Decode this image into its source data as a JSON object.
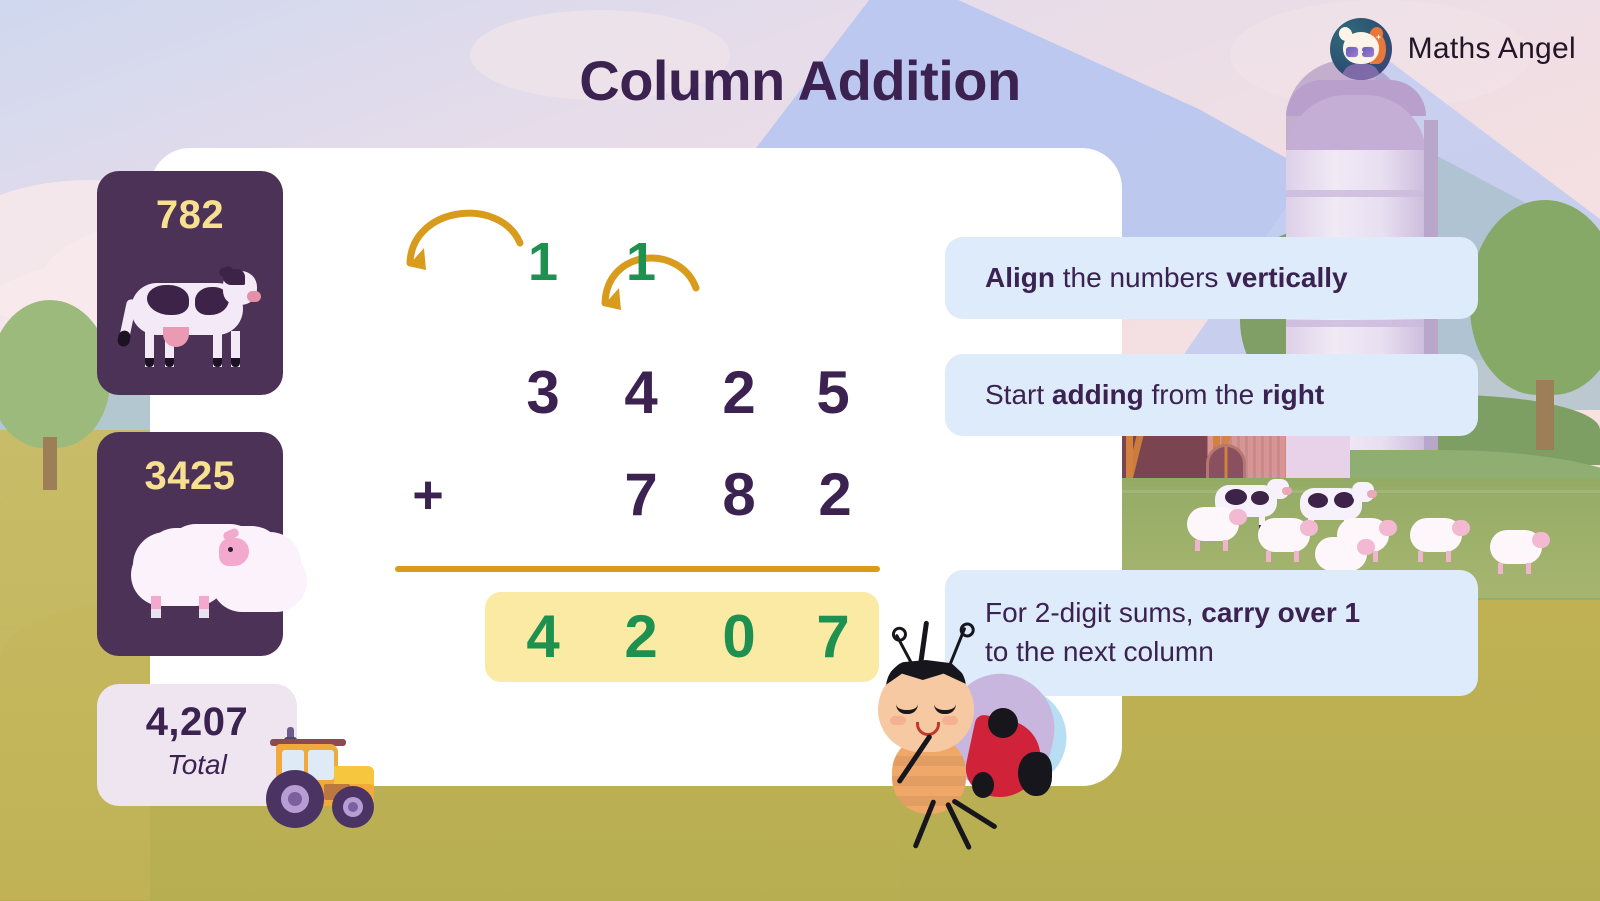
{
  "header": {
    "title": "Column Addition",
    "brand_name": "Maths Angel",
    "logo_icon": "fox-avatar-icon"
  },
  "cards": [
    {
      "name": "cow-card",
      "value": "782",
      "animal": "cow-illustration"
    },
    {
      "name": "sheep-card",
      "value": "3425",
      "animal": "sheep-illustration"
    }
  ],
  "total_card": {
    "value": "4,207",
    "label": "Total"
  },
  "sum": {
    "operator": "+",
    "carries": [
      "1",
      "1"
    ],
    "addend1": [
      "3",
      "4",
      "2",
      "5"
    ],
    "addend2": [
      "7",
      "8",
      "2"
    ],
    "result": [
      "4",
      "2",
      "0",
      "7"
    ],
    "arrow_icon": "carry-arrow-icon"
  },
  "callouts": [
    {
      "name": "callout-align",
      "segments": [
        {
          "text": "Align",
          "bold": true
        },
        {
          "text": " the numbers ",
          "bold": false
        },
        {
          "text": "vertically",
          "bold": true
        }
      ]
    },
    {
      "name": "callout-start-right",
      "segments": [
        {
          "text": "Start ",
          "bold": false
        },
        {
          "text": "adding",
          "bold": true
        },
        {
          "text": " from the ",
          "bold": false
        },
        {
          "text": "right",
          "bold": true
        }
      ]
    },
    {
      "name": "callout-carry-over",
      "segments": [
        {
          "text": "For 2-digit sums, ",
          "bold": false
        },
        {
          "text": "carry over  1",
          "bold": true
        },
        {
          "text": "\nto the next column",
          "bold": false
        }
      ]
    }
  ],
  "mascot": {
    "name": "ladybug-mascot",
    "icon": "ladybug-icon"
  },
  "scene": {
    "tractor": "tractor-illustration",
    "barn": "barn-illustration",
    "silo": "silo-illustration"
  },
  "colors": {
    "title": "#3B2250",
    "card_dark": "#4D3258",
    "card_number": "#F7E08F",
    "total_card": "#EFE5F0",
    "result_green": "#1E9150",
    "result_band": "#FBEAA4",
    "rule_gold": "#D99B1C",
    "callout_bg": "#DDEBFB",
    "panel": "#FFFFFF"
  }
}
